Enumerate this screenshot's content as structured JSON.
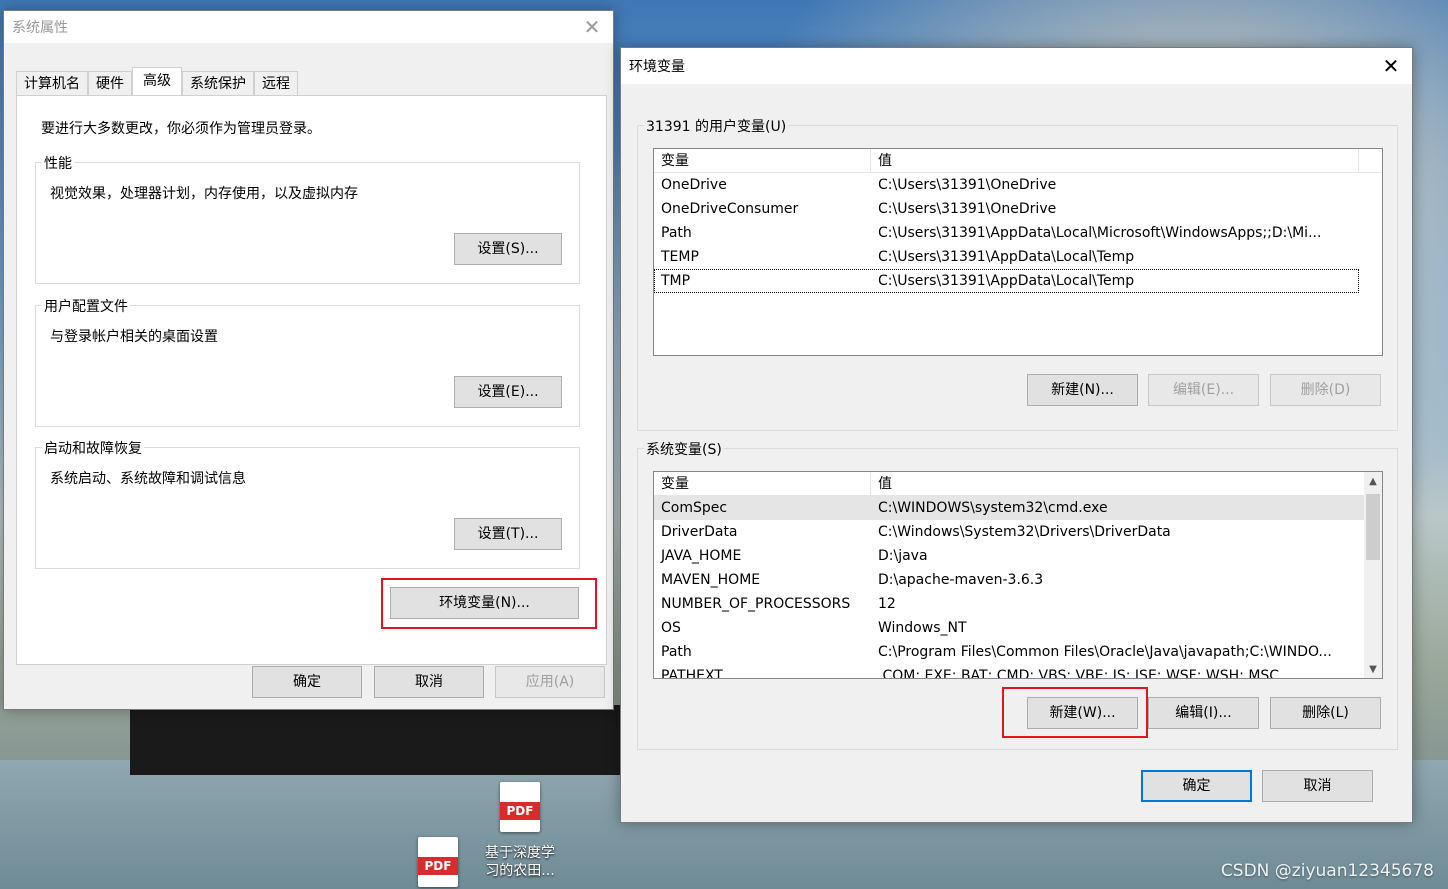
{
  "sysprops": {
    "title": "系统属性",
    "tabs": [
      "计算机名",
      "硬件",
      "高级",
      "系统保护",
      "远程"
    ],
    "active_tab": 2,
    "admin_note": "要进行大多数更改，你必须作为管理员登录。",
    "performance": {
      "label": "性能",
      "desc": "视觉效果，处理器计划，内存使用，以及虚拟内存",
      "button": "设置(S)..."
    },
    "profiles": {
      "label": "用户配置文件",
      "desc": "与登录帐户相关的桌面设置",
      "button": "设置(E)..."
    },
    "startup": {
      "label": "启动和故障恢复",
      "desc": "系统启动、系统故障和调试信息",
      "button": "设置(T)..."
    },
    "env_button": "环境变量(N)...",
    "ok": "确定",
    "cancel": "取消",
    "apply": "应用(A)"
  },
  "envvars": {
    "title": "环境变量",
    "user_label": "31391 的用户变量(U)",
    "user_columns": [
      "变量",
      "值"
    ],
    "user_rows": [
      [
        "OneDrive",
        "C:\\Users\\31391\\OneDrive"
      ],
      [
        "OneDriveConsumer",
        "C:\\Users\\31391\\OneDrive"
      ],
      [
        "Path",
        "C:\\Users\\31391\\AppData\\Local\\Microsoft\\WindowsApps;;D:\\Mi..."
      ],
      [
        "TEMP",
        "C:\\Users\\31391\\AppData\\Local\\Temp"
      ],
      [
        "TMP",
        "C:\\Users\\31391\\AppData\\Local\\Temp"
      ]
    ],
    "user_buttons": {
      "new": "新建(N)...",
      "edit": "编辑(E)...",
      "delete": "删除(D)"
    },
    "sys_label": "系统变量(S)",
    "sys_columns": [
      "变量",
      "值"
    ],
    "sys_rows": [
      [
        "ComSpec",
        "C:\\WINDOWS\\system32\\cmd.exe"
      ],
      [
        "DriverData",
        "C:\\Windows\\System32\\Drivers\\DriverData"
      ],
      [
        "JAVA_HOME",
        "D:\\java"
      ],
      [
        "MAVEN_HOME",
        "D:\\apache-maven-3.6.3"
      ],
      [
        "NUMBER_OF_PROCESSORS",
        "12"
      ],
      [
        "OS",
        "Windows_NT"
      ],
      [
        "Path",
        "C:\\Program Files\\Common Files\\Oracle\\Java\\javapath;C:\\WINDO..."
      ],
      [
        "PATHEXT",
        ".COM;.EXE;.BAT;.CMD;.VBS;.VBE;.JS;.JSE;.WSF;.WSH;.MSC"
      ]
    ],
    "sys_buttons": {
      "new": "新建(W)...",
      "edit": "编辑(I)...",
      "delete": "删除(L)"
    },
    "ok": "确定",
    "cancel": "取消"
  },
  "desktop": {
    "icons": [
      {
        "badge": "PDF",
        "label_line1": "基于深度学",
        "label_line2": "习的农田..."
      },
      {
        "badge": "PDF",
        "label_line1": "",
        "label_line2": ""
      }
    ],
    "watermark": "CSDN @ziyuan12345678"
  },
  "colors": {
    "highlight": "#e81123",
    "accent": "#0078d7",
    "pdf": "#d92b2b"
  }
}
